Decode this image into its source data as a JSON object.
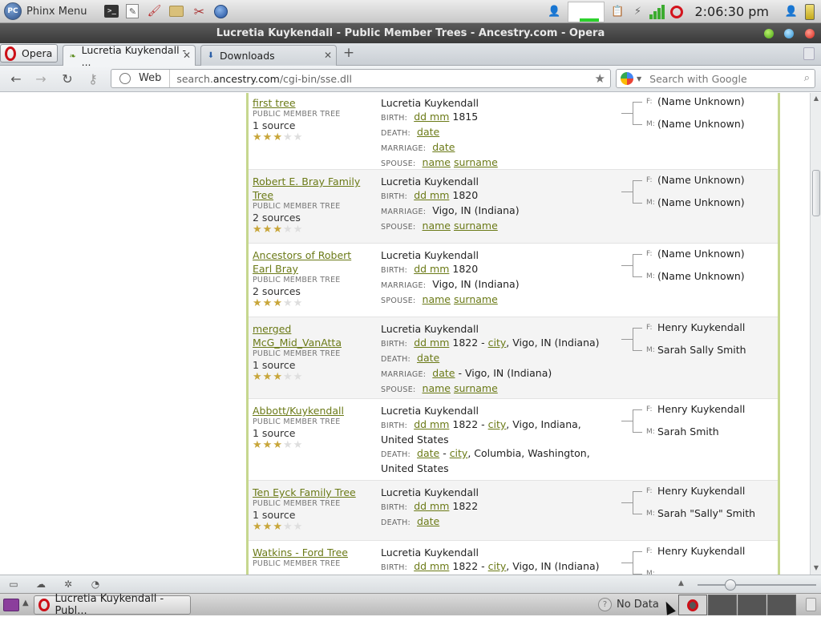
{
  "top_panel": {
    "menu_logo_text": "PC",
    "menu_label": "Phinx Menu",
    "clock": "2:06:30 pm",
    "icons": [
      "terminal-icon",
      "text-editor-icon",
      "paint-icon",
      "folder-icon",
      "tools-icon",
      "globe-icon",
      "user-icon",
      "clipboard-icon",
      "network-icon",
      "signal-icon",
      "opera-icon",
      "user-switch-icon",
      "battery-icon"
    ]
  },
  "window": {
    "title": "Lucretia Kuykendall - Public Member Trees - Ancestry.com - Opera"
  },
  "tabs": {
    "opera_button": "Opera",
    "items": [
      {
        "label": "Lucretia Kuykendall - ...",
        "active": true
      },
      {
        "label": "Downloads",
        "active": false
      }
    ]
  },
  "address_bar": {
    "web_label": "Web",
    "url_prefix": "search.",
    "url_domain": "ancestry.com",
    "url_path": "/cgi-bin/sse.dll",
    "search_placeholder": "Search with Google"
  },
  "results": [
    {
      "tree_name": "first tree",
      "tree_type": "PUBLIC MEMBER TREE",
      "sources": "1 source",
      "stars": 3,
      "person": "Lucretia Kuykendall",
      "facts": [
        {
          "label": "BIRTH:",
          "links": [
            "dd mm"
          ],
          "text": " 1815"
        },
        {
          "label": "DEATH:",
          "links": [
            "date"
          ],
          "text": ""
        },
        {
          "label": "MARRIAGE:",
          "links": [
            "date"
          ],
          "text": ""
        },
        {
          "label": "SPOUSE:",
          "links": [
            "name",
            "surname"
          ],
          "text": ""
        }
      ],
      "father": "(Name Unknown)",
      "mother": "(Name Unknown)"
    },
    {
      "tree_name": "Robert E. Bray Family Tree",
      "tree_type": "PUBLIC MEMBER TREE",
      "sources": "2 sources",
      "stars": 3,
      "person": "Lucretia Kuykendall",
      "facts": [
        {
          "label": "BIRTH:",
          "links": [
            "dd mm"
          ],
          "text": " 1820"
        },
        {
          "label": "MARRIAGE:",
          "links": [],
          "text": "Vigo, IN (Indiana)"
        },
        {
          "label": "SPOUSE:",
          "links": [
            "name",
            "surname"
          ],
          "text": ""
        }
      ],
      "father": "(Name Unknown)",
      "mother": "(Name Unknown)"
    },
    {
      "tree_name": "Ancestors of Robert Earl Bray",
      "tree_type": "PUBLIC MEMBER TREE",
      "sources": "2 sources",
      "stars": 3,
      "person": "Lucretia Kuykendall",
      "facts": [
        {
          "label": "BIRTH:",
          "links": [
            "dd mm"
          ],
          "text": " 1820"
        },
        {
          "label": "MARRIAGE:",
          "links": [],
          "text": "Vigo, IN (Indiana)"
        },
        {
          "label": "SPOUSE:",
          "links": [
            "name",
            "surname"
          ],
          "text": ""
        }
      ],
      "father": "(Name Unknown)",
      "mother": "(Name Unknown)"
    },
    {
      "tree_name": "merged McG_Mid_VanAtta",
      "tree_type": "PUBLIC MEMBER TREE",
      "sources": "1 source",
      "stars": 3,
      "person": "Lucretia Kuykendall",
      "facts": [
        {
          "label": "BIRTH:",
          "links": [
            "dd mm"
          ],
          "text": " 1822 - ",
          "link2": "city",
          "text2": ", Vigo, IN (Indiana)"
        },
        {
          "label": "DEATH:",
          "links": [
            "date"
          ],
          "text": ""
        },
        {
          "label": "MARRIAGE:",
          "links": [
            "date"
          ],
          "text": " - Vigo, IN (Indiana)"
        },
        {
          "label": "SPOUSE:",
          "links": [
            "name",
            "surname"
          ],
          "text": ""
        }
      ],
      "father": "Henry Kuykendall",
      "mother": "Sarah Sally Smith"
    },
    {
      "tree_name": "Abbott/Kuykendall",
      "tree_type": "PUBLIC MEMBER TREE",
      "sources": "1 source",
      "stars": 3,
      "person": "Lucretia Kuykendall",
      "facts": [
        {
          "label": "BIRTH:",
          "links": [
            "dd mm"
          ],
          "text": " 1822 - ",
          "link2": "city",
          "text2": ", Vigo, Indiana, United States"
        },
        {
          "label": "DEATH:",
          "links": [
            "date"
          ],
          "text": " - ",
          "link2": "city",
          "text2": ", Columbia, Washington, United States"
        }
      ],
      "father": "Henry Kuykendall",
      "mother": "Sarah Smith"
    },
    {
      "tree_name": "Ten Eyck Family Tree",
      "tree_type": "PUBLIC MEMBER TREE",
      "sources": "1 source",
      "stars": 3,
      "person": "Lucretia Kuykendall",
      "facts": [
        {
          "label": "BIRTH:",
          "links": [
            "dd mm"
          ],
          "text": " 1822"
        },
        {
          "label": "DEATH:",
          "links": [
            "date"
          ],
          "text": ""
        }
      ],
      "father": "Henry Kuykendall",
      "mother": "Sarah \"Sally\" Smith"
    },
    {
      "tree_name": "Watkins - Ford Tree",
      "tree_type": "PUBLIC MEMBER TREE",
      "sources": "",
      "stars": 0,
      "person": "Lucretia Kuykendall",
      "facts": [
        {
          "label": "BIRTH:",
          "links": [
            "dd mm"
          ],
          "text": " 1822 - ",
          "link2": "city",
          "text2": ", Vigo, IN (Indiana)"
        }
      ],
      "father": "Henry Kuykendall",
      "mother": ""
    }
  ],
  "parent_labels": {
    "father": "F:",
    "mother": "M:"
  },
  "taskbar": {
    "task_label": "Lucretia Kuykendall - Publ...",
    "status": "No Data"
  }
}
